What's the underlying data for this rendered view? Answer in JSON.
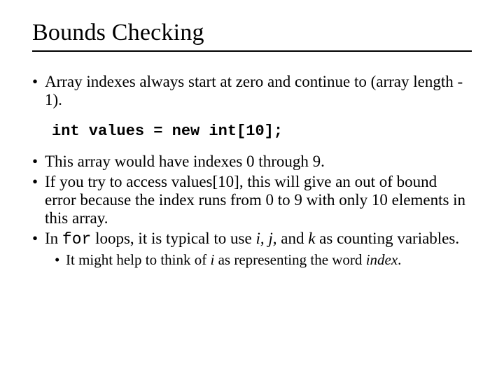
{
  "title": "Bounds Checking",
  "bullets": {
    "b1": "Array indexes always start at zero and continue to (array length - 1).",
    "code": "int values = new int[10];",
    "b2": "This array would have indexes 0 through 9.",
    "b3_pre": "If you try to access values[10], this will give an out of bound error because the index runs from 0 to 9 with only 10 elements in this array.",
    "b4_pre": "In ",
    "b4_code": "for",
    "b4_mid": " loops, it is typical to use ",
    "b4_ijk": "i, j,",
    "b4_and": " and ",
    "b4_k": "k",
    "b4_post": " as counting variables.",
    "sub_pre": "It might help to think of ",
    "sub_i": "i",
    "sub_mid": " as representing the word ",
    "sub_index": "index",
    "sub_post": "."
  }
}
